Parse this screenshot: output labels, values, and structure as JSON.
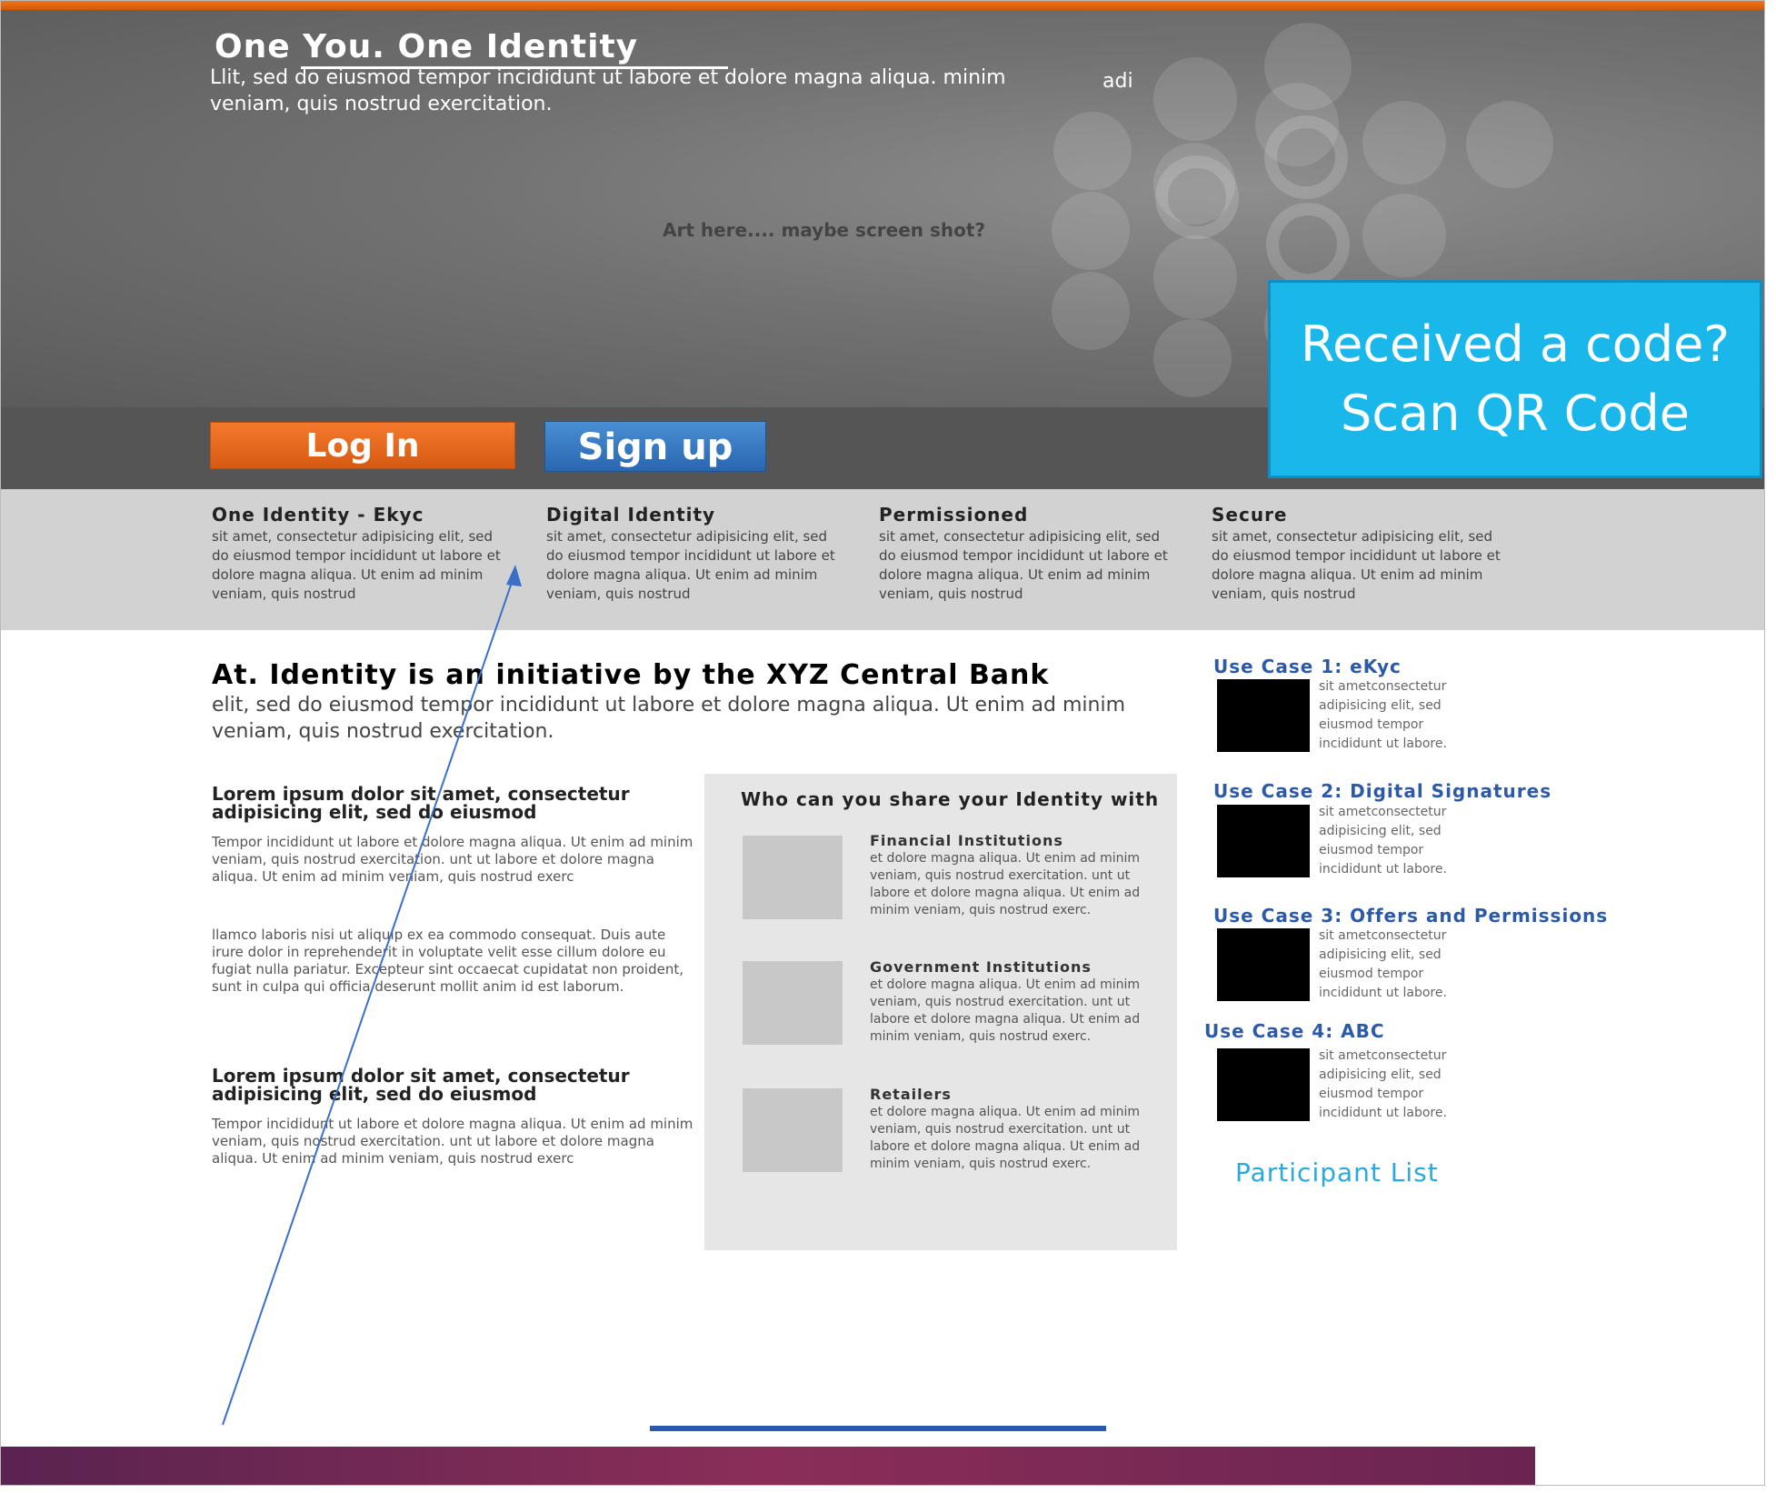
{
  "hero": {
    "title": "One You. One Identity",
    "subtitle": "Llit, sed do eiusmod tempor incididunt ut labore et dolore magna aliqua. minim veniam, quis nostrud exercitation.",
    "side_word": "adi",
    "art_placeholder": "Art here.... maybe screen shot?"
  },
  "cta": {
    "login_label": "Log In",
    "signup_label": "Sign up"
  },
  "qr": {
    "line1": "Received a code?",
    "line2": "Scan QR Code"
  },
  "features": [
    {
      "title": "One Identity - Ekyc",
      "text": "sit amet, consectetur adipisicing elit, sed do eiusmod tempor incididunt ut labore et dolore magna aliqua. Ut enim ad minim veniam, quis nostrud"
    },
    {
      "title": "Digital Identity",
      "text": "sit amet, consectetur adipisicing elit, sed do eiusmod tempor incididunt ut labore et dolore magna aliqua. Ut enim ad minim veniam, quis nostrud"
    },
    {
      "title": "Permissioned",
      "text": "sit amet, consectetur adipisicing elit, sed do eiusmod tempor incididunt ut labore et dolore magna aliqua. Ut enim ad minim veniam, quis nostrud"
    },
    {
      "title": "Secure",
      "text": "sit amet, consectetur adipisicing elit, sed do eiusmod tempor incididunt ut labore et dolore magna aliqua. Ut enim ad minim veniam, quis nostrud"
    }
  ],
  "main": {
    "title": "At. Identity is an initiative by the XYZ Central Bank",
    "subtitle": "elit, sed do eiusmod tempor incididunt ut labore et dolore magna aliqua. Ut enim ad minim veniam, quis nostrud exercitation."
  },
  "sections": [
    {
      "heading": "Lorem ipsum dolor sit amet, consectetur adipisicing elit, sed do eiusmod",
      "para1": "Tempor incididunt ut labore et dolore magna aliqua. Ut enim ad minim veniam, quis nostrud exercitation. unt ut labore et dolore magna aliqua. Ut enim ad minim veniam, quis nostrud exerc",
      "para2": "llamco laboris nisi ut aliquip ex ea commodo consequat. Duis aute irure dolor in reprehenderit in voluptate velit esse cillum dolore eu fugiat nulla pariatur. Excepteur sint occaecat cupidatat non proident, sunt in culpa qui officia deserunt mollit anim id est laborum."
    },
    {
      "heading": "Lorem ipsum dolor sit amet, consectetur adipisicing elit, sed do eiusmod",
      "para1": "Tempor incididunt ut labore et dolore magna aliqua. Ut enim ad minim veniam, quis nostrud exercitation. unt ut labore et dolore magna aliqua. Ut enim ad minim veniam, quis nostrud exerc"
    }
  ],
  "share": {
    "title": "Who can you share your Identity with",
    "items": [
      {
        "heading": "Financial Institutions",
        "text": "et dolore magna aliqua. Ut enim ad minim veniam, quis nostrud exercitation. unt ut labore et dolore magna aliqua. Ut enim ad minim veniam, quis nostrud exerc."
      },
      {
        "heading": "Government Institutions",
        "text": "et dolore magna aliqua. Ut enim ad minim veniam, quis nostrud exercitation. unt ut labore et dolore magna aliqua. Ut enim ad minim veniam, quis nostrud exerc."
      },
      {
        "heading": "Retailers",
        "text": "et dolore magna aliqua. Ut enim ad minim veniam, quis nostrud exercitation. unt ut labore et dolore magna aliqua. Ut enim ad minim veniam, quis nostrud exerc."
      }
    ]
  },
  "use_cases": [
    {
      "title": "Use Case 1: eKyc",
      "text": "sit ametconsectetur adipisicing elit, sed eiusmod tempor incididunt ut labore."
    },
    {
      "title": "Use Case 2: Digital Signatures",
      "text": "sit ametconsectetur adipisicing elit, sed eiusmod tempor incididunt ut labore."
    },
    {
      "title": "Use Case 3: Offers and Permissions",
      "text": "sit ametconsectetur adipisicing elit, sed eiusmod tempor incididunt ut labore."
    },
    {
      "title": "Use Case 4: ABC",
      "text": "sit ametconsectetur adipisicing elit, sed eiusmod tempor incididunt ut labore."
    }
  ],
  "participant_label": "Participant List",
  "colors": {
    "orange": "#f0751e",
    "blue_button": "#2866b0",
    "qr_cyan": "#19b7ea",
    "use_case_blue": "#2c5aa8",
    "participant_blue": "#29a9e0",
    "footer_purple": "#8a2e58"
  }
}
